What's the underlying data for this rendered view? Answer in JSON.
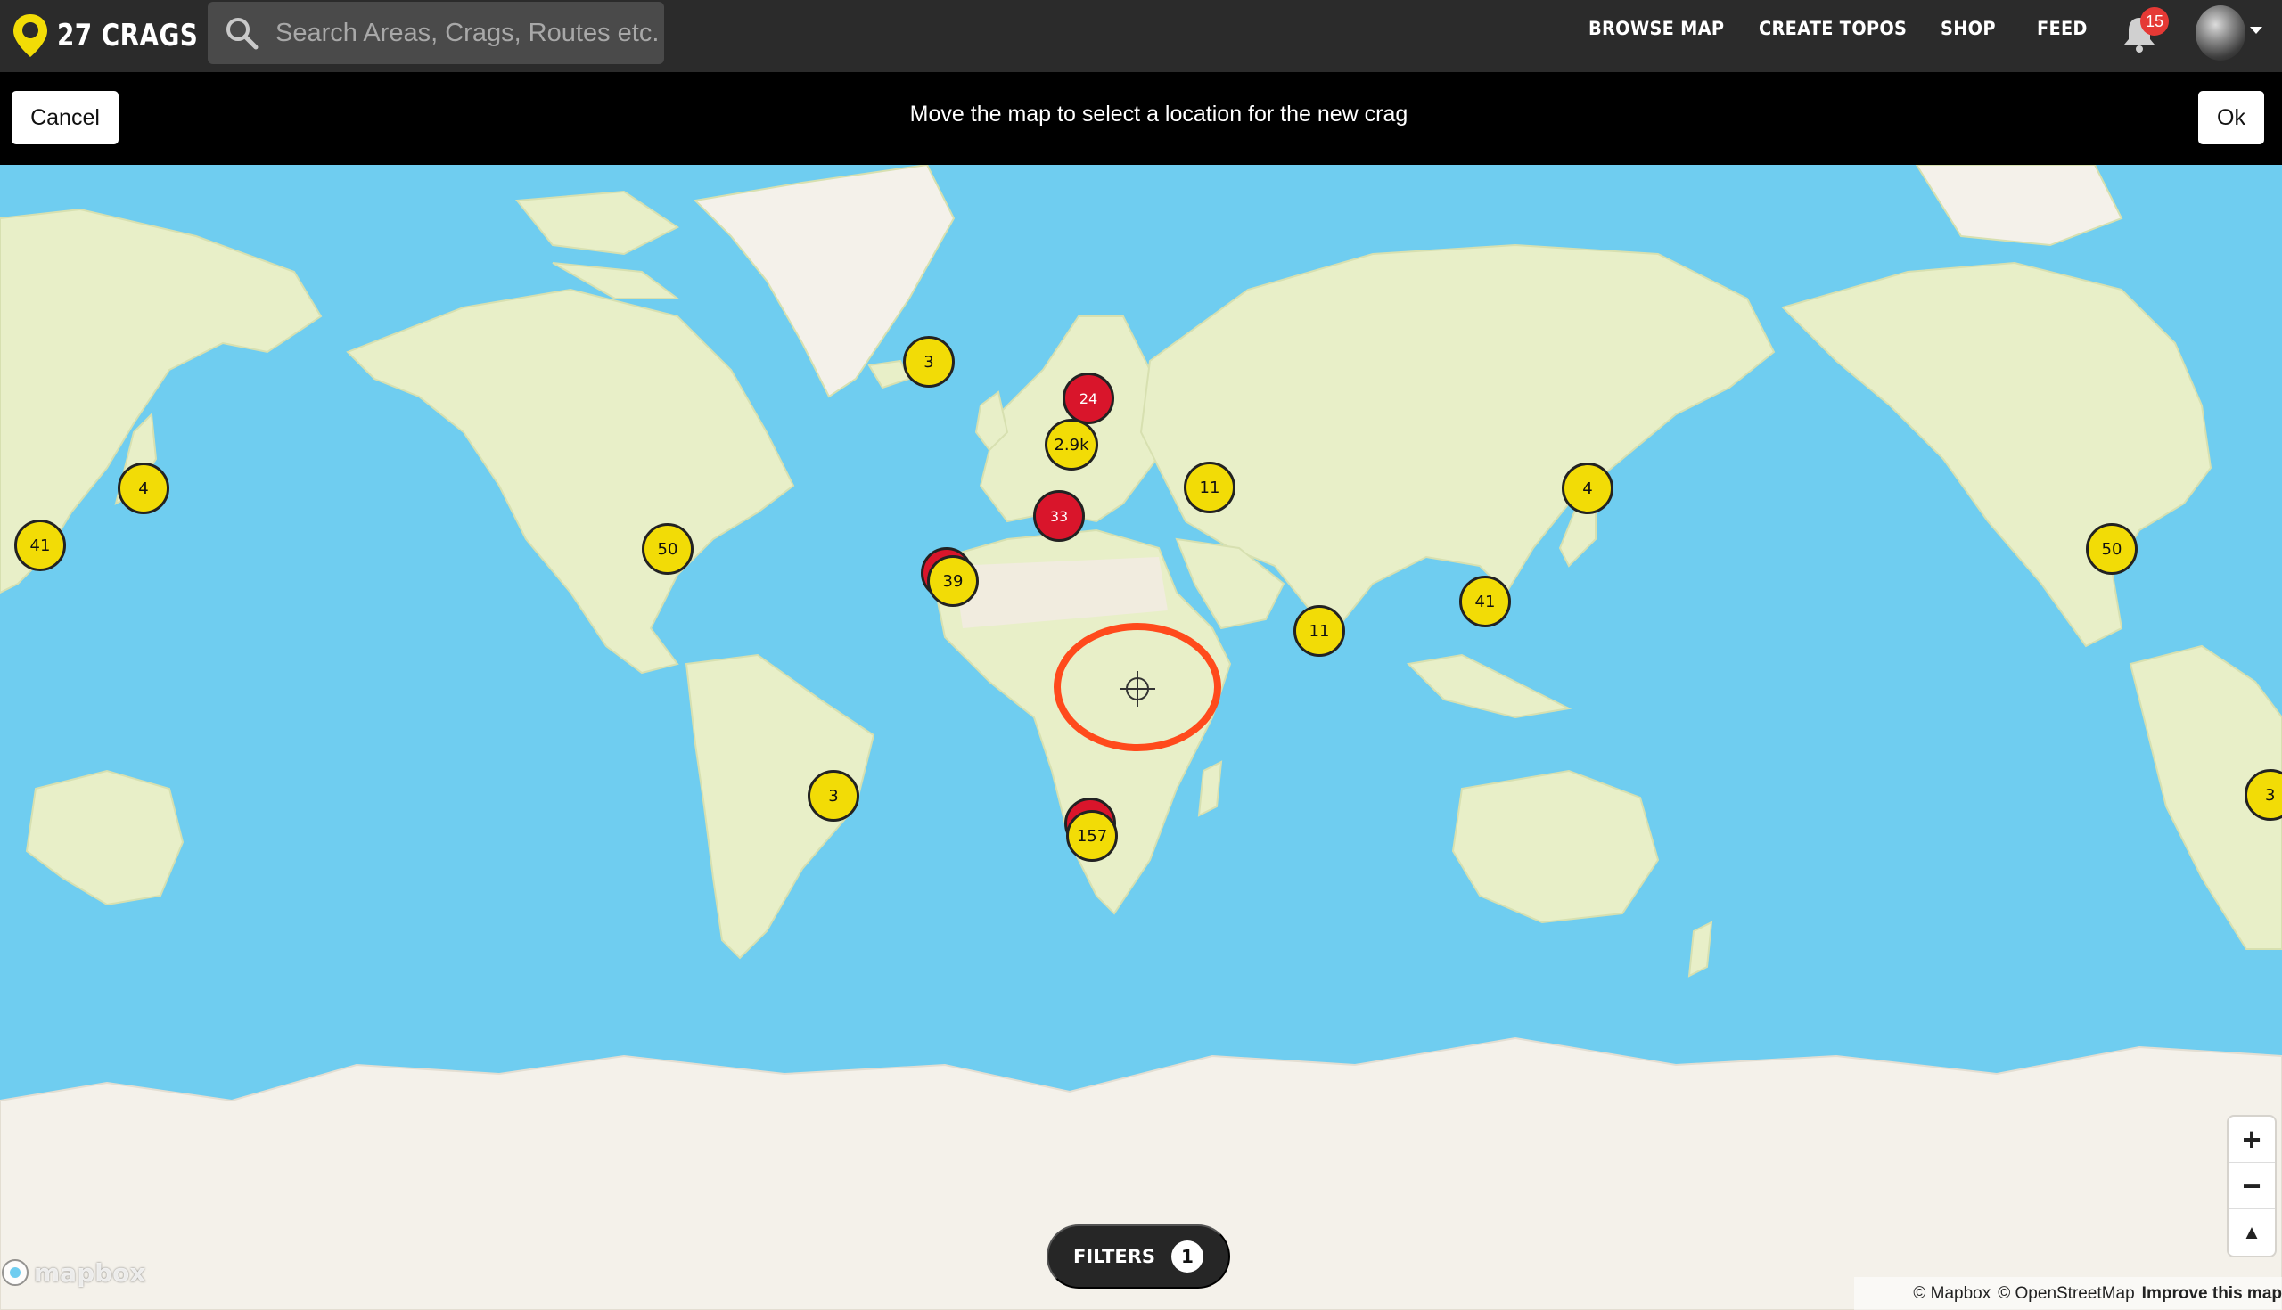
{
  "brand": {
    "name": "27 CRAGS"
  },
  "search": {
    "placeholder": "Search Areas, Crags, Routes etc."
  },
  "nav": [
    {
      "label": "BROWSE MAP"
    },
    {
      "label": "CREATE TOPOS"
    },
    {
      "label": "SHOP"
    },
    {
      "label": "FEED"
    }
  ],
  "notifications": {
    "count": "15"
  },
  "actionbar": {
    "cancel_label": "Cancel",
    "message": "Move the map to select a location for the new crag",
    "ok_label": "Ok"
  },
  "clusters": [
    {
      "label": "4"
    },
    {
      "label": "41"
    },
    {
      "label": "50"
    },
    {
      "label": "3"
    },
    {
      "label": "24"
    },
    {
      "label": "2.9k"
    },
    {
      "label": "33"
    },
    {
      "label": "11"
    },
    {
      "label": "39"
    },
    {
      "label": "11"
    },
    {
      "label": "41"
    },
    {
      "label": "4"
    },
    {
      "label": "3"
    },
    {
      "label": "157"
    },
    {
      "label": "50"
    },
    {
      "label": "3"
    }
  ],
  "filters": {
    "label": "FILTERS",
    "count": "1"
  },
  "zoom": {
    "in": "+",
    "out": "−",
    "compass": "▲"
  },
  "map": {
    "provider_logo": "mapbox",
    "attribution_mapbox": "© Mapbox",
    "attribution_osm": "© OpenStreetMap",
    "improve": "Improve this map"
  },
  "colors": {
    "ocean": "#6fcdf0",
    "land": "#e8efc8",
    "ice": "#f4f1ea",
    "cluster_yellow": "#f2dc06",
    "cluster_red": "#d9152b",
    "target_ring": "#ff4a1c",
    "brand_yellow": "#f2dc06"
  }
}
